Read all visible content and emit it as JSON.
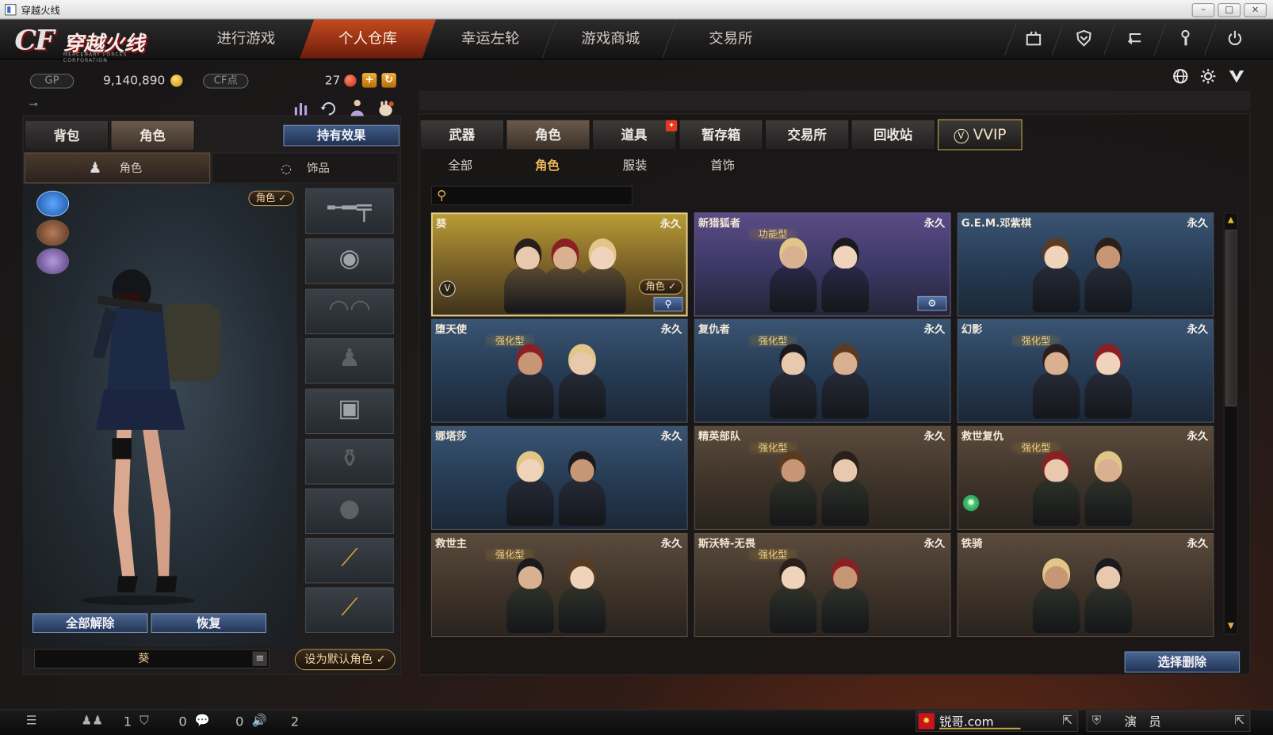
{
  "window": {
    "title": "穿越火线",
    "controls": [
      "–",
      "□",
      "×"
    ]
  },
  "logo": {
    "brand": "CF",
    "name": "穿越火线",
    "subtitle": "MERCENARY FORCES CORPORATION"
  },
  "nav": {
    "tabs": [
      {
        "label": "进行游戏",
        "active": false
      },
      {
        "label": "个人仓库",
        "active": true
      },
      {
        "label": "幸运左轮",
        "active": false
      },
      {
        "label": "游戏商城",
        "active": false
      },
      {
        "label": "交易所",
        "active": false
      }
    ],
    "icons": [
      "bag-icon",
      "shield-icon",
      "return-icon",
      "key-icon",
      "power-icon"
    ]
  },
  "currency": {
    "gp_label": "GP",
    "gp_value": "9,140,890",
    "cf_label": "CF点",
    "cf_value": "27",
    "plus": "+",
    "refresh": "↻"
  },
  "right_header_icons": [
    "globe-icon",
    "gear-icon",
    "vip-icon"
  ],
  "left": {
    "tabs": [
      {
        "label": "背包",
        "active": false
      },
      {
        "label": "角色",
        "active": true
      }
    ],
    "hold_effect": "持有效果",
    "subtabs": [
      {
        "label": "角色",
        "active": true
      },
      {
        "label": "饰品",
        "active": false
      }
    ],
    "role_tag": "角色 ✓",
    "unequip_all": "全部解除",
    "restore": "恢复",
    "character_name": "葵",
    "set_default": "设为默认角色 ✓"
  },
  "categories": {
    "tabs": [
      {
        "label": "武器",
        "active": false
      },
      {
        "label": "角色",
        "active": true
      },
      {
        "label": "道具",
        "active": false
      },
      {
        "label": "暂存箱",
        "active": false
      },
      {
        "label": "交易所",
        "active": false
      },
      {
        "label": "回收站",
        "active": false
      },
      {
        "label": "VVIP",
        "active": false
      }
    ],
    "filters": [
      {
        "label": "全部",
        "active": false
      },
      {
        "label": "角色",
        "active": true
      },
      {
        "label": "服装",
        "active": false
      },
      {
        "label": "首饰",
        "active": false
      }
    ],
    "search_placeholder": ""
  },
  "cards": [
    {
      "name": "葵",
      "duration": "永久",
      "type": "",
      "theme": "gold",
      "selected": true,
      "role_pill": "角色 ✓"
    },
    {
      "name": "新猎狐者",
      "duration": "永久",
      "type": "功能型",
      "theme": "purple",
      "selected": false
    },
    {
      "name": "G.E.M.邓紫棋",
      "duration": "永久",
      "type": "",
      "theme": "blue",
      "selected": false
    },
    {
      "name": "堕天使",
      "duration": "永久",
      "type": "强化型",
      "theme": "blue",
      "selected": false
    },
    {
      "name": "复仇者",
      "duration": "永久",
      "type": "强化型",
      "theme": "blue",
      "selected": false
    },
    {
      "name": "幻影",
      "duration": "永久",
      "type": "强化型",
      "theme": "blue",
      "selected": false
    },
    {
      "name": "娜塔莎",
      "duration": "永久",
      "type": "",
      "theme": "blue",
      "selected": false
    },
    {
      "name": "精英部队",
      "duration": "永久",
      "type": "强化型",
      "theme": "brown",
      "selected": false
    },
    {
      "name": "救世复仇",
      "duration": "永久",
      "type": "强化型",
      "theme": "brown",
      "selected": false
    },
    {
      "name": "救世主",
      "duration": "永久",
      "type": "强化型",
      "theme": "brown",
      "selected": false
    },
    {
      "name": "斯沃特-无畏",
      "duration": "永久",
      "type": "强化型",
      "theme": "brown",
      "selected": false
    },
    {
      "name": "铁骑",
      "duration": "永久",
      "type": "",
      "theme": "brown",
      "selected": false
    }
  ],
  "select_delete": "选择删除",
  "statusbar": {
    "friends": "1",
    "clan": "0",
    "chat": "0",
    "volume": "2",
    "site": "锐哥.com",
    "rank": "演　员"
  },
  "colors": {
    "accent_orange": "#c54a1f",
    "gold": "#d7a23b",
    "button_blue": "#3f5b86"
  }
}
